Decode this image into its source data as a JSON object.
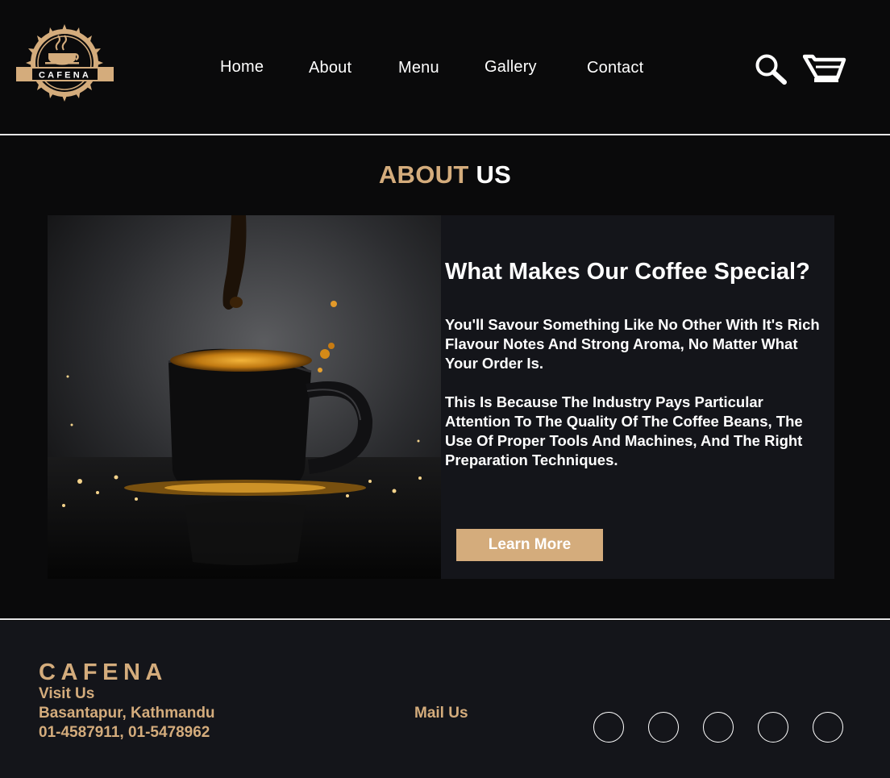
{
  "brand": {
    "logo_text": "CAFENA"
  },
  "nav": {
    "items": [
      "Home",
      "About",
      "Menu",
      "Gallery",
      "Contact"
    ]
  },
  "header_icons": {
    "search": "search-icon",
    "cart": "cart-icon"
  },
  "about": {
    "title_accent": "ABOUT",
    "title_rest": "US",
    "heading": "What Makes Our Coffee Special?",
    "paragraph1": "You'll Savour Something Like No Other With It's Rich Flavour Notes And Strong Aroma, No Matter What Your Order Is.",
    "paragraph2": "This Is Because The Industry Pays Particular Attention To The Quality Of The Coffee Beans, The Use Of Proper Tools And Machines, And The Right Preparation Techniques.",
    "button_label": "Learn More",
    "image": "coffee-cup-photo"
  },
  "footer": {
    "brand": "CAFENA",
    "visit_label": "Visit Us",
    "address": "Basantapur, Kathmandu",
    "phones": "01-4587911, 01-5478962",
    "mail_label": "Mail Us",
    "social_count": 5
  },
  "colors": {
    "accent": "#d4ac7c",
    "background": "#0a0a0b",
    "panel": "#14151a",
    "text": "#ffffff"
  }
}
